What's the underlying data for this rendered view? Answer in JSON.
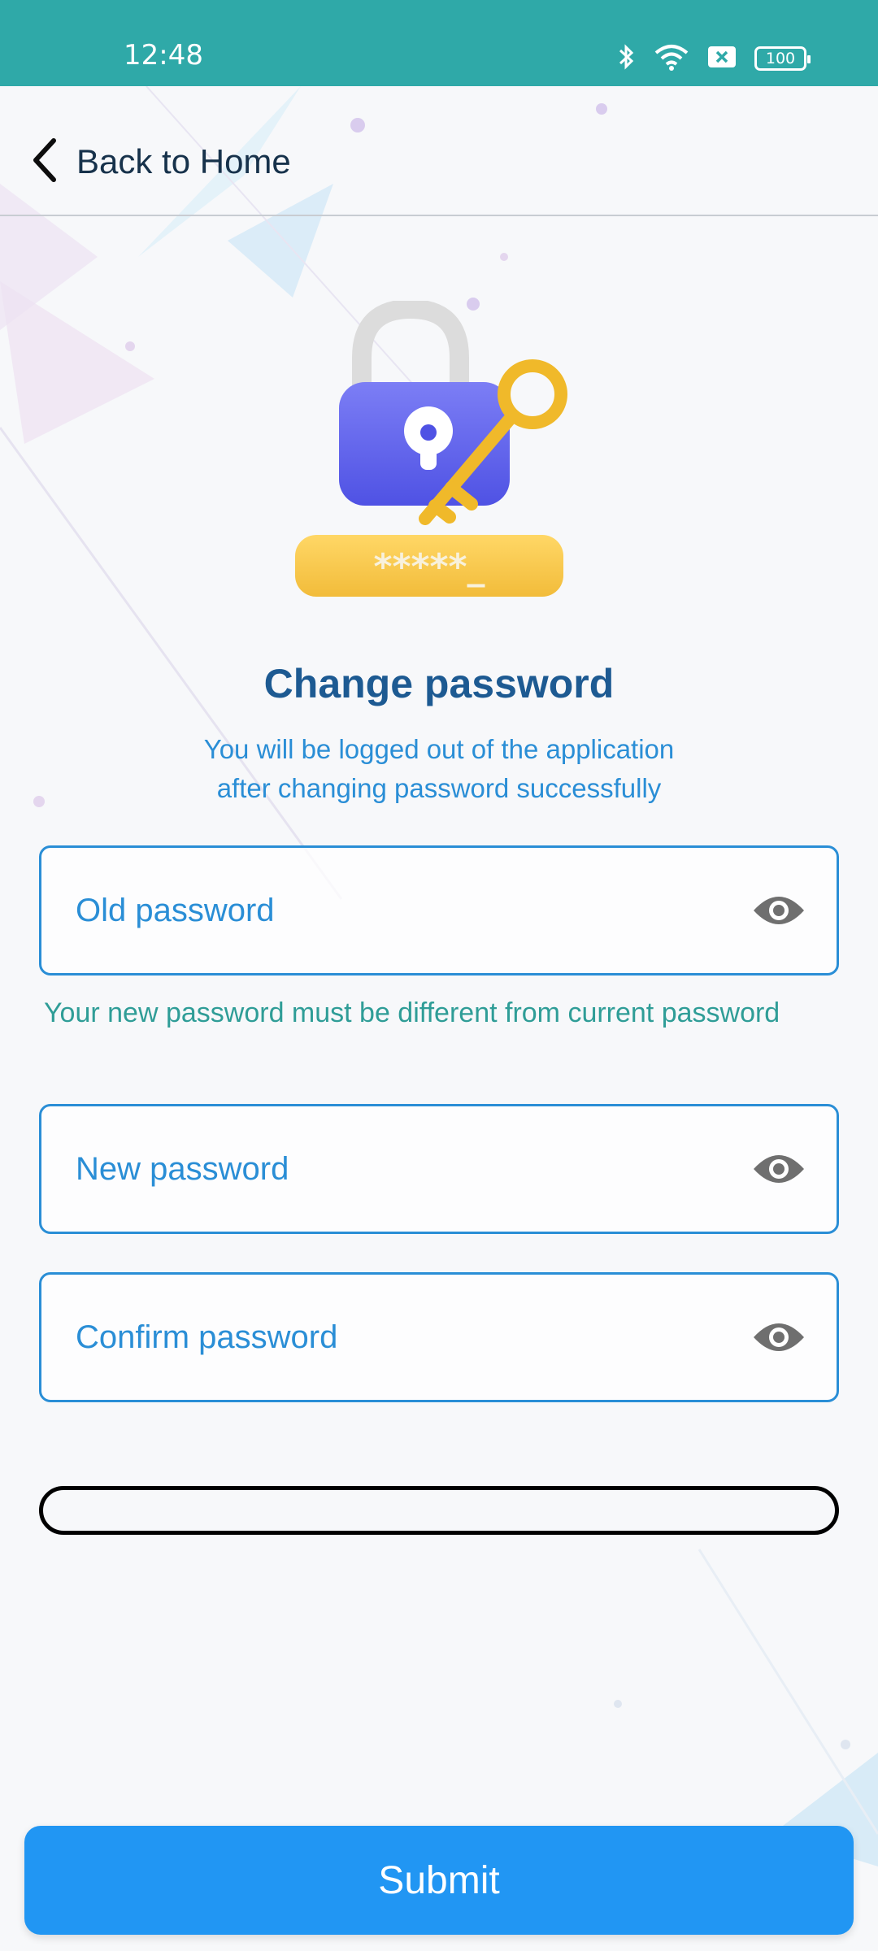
{
  "status_bar": {
    "time": "12:48",
    "battery": "100",
    "icons": [
      "bluetooth-icon",
      "wifi-icon",
      "sim-x-icon",
      "battery-icon"
    ]
  },
  "header": {
    "back_label": "Back to Home",
    "back_icon": "chevron-left-icon"
  },
  "illustration": {
    "icon": "lock-with-key-illustration",
    "password_mask": "*****_"
  },
  "page": {
    "title": "Change password",
    "subtitle_line1": "You will be logged out of the application",
    "subtitle_line2": "after changing password successfully"
  },
  "form": {
    "old_password": {
      "placeholder": "Old password",
      "value": "",
      "toggle_icon": "eye-icon"
    },
    "hint": "Your new password must be different from current password",
    "new_password": {
      "placeholder": "New password",
      "value": "",
      "toggle_icon": "eye-icon"
    },
    "confirm_password": {
      "placeholder": "Confirm password",
      "value": "",
      "toggle_icon": "eye-icon"
    }
  },
  "submit_label": "Submit",
  "colors": {
    "status_bar": "#2fa9a8",
    "accent": "#2a8ed6",
    "title": "#1d5a92",
    "hint": "#2f9d97",
    "submit": "#2196f3"
  }
}
